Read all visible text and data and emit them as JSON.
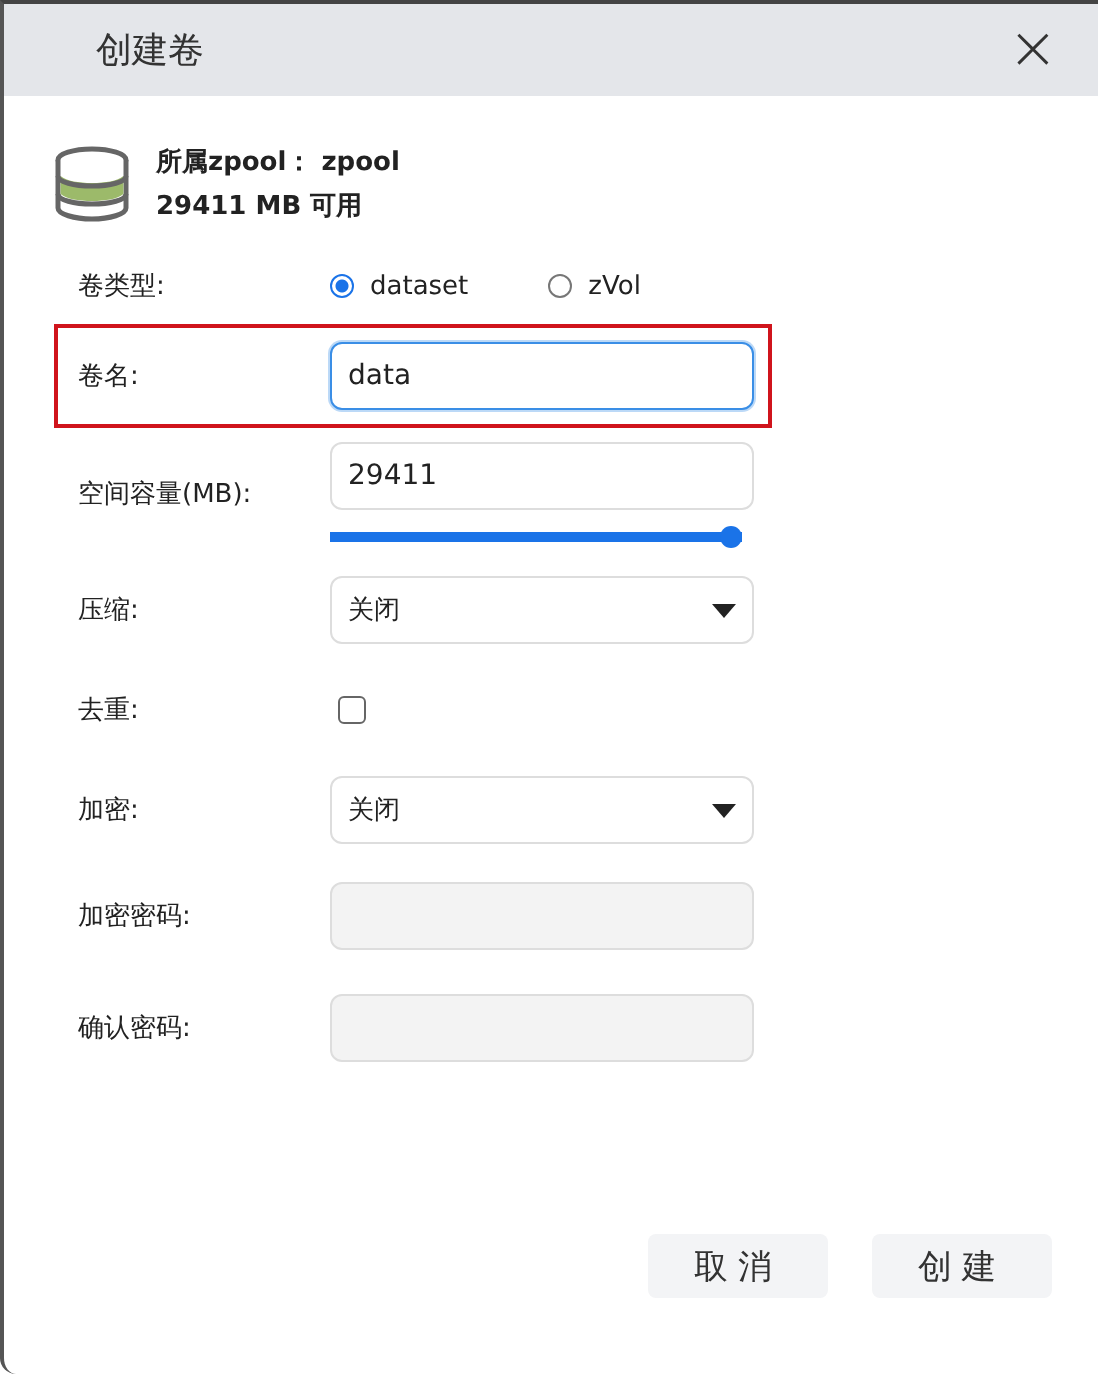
{
  "window": {
    "title": "创建卷",
    "close": "×"
  },
  "pool": {
    "name_line": "所属zpool： zpool",
    "free_line": "29411 MB 可用"
  },
  "fields": [
    {
      "kind": "radio",
      "label": "卷类型:",
      "options": [
        {
          "label": "dataset",
          "selected": true
        },
        {
          "label": "zVol",
          "selected": false
        }
      ]
    },
    {
      "kind": "text",
      "label": "卷名:",
      "value": "data",
      "focused": true,
      "highlighted": true
    },
    {
      "kind": "number",
      "label": "空间容量(MB):",
      "value": "29411",
      "level": 1
    },
    {
      "kind": "select",
      "label": "压缩:",
      "value": "关闭"
    },
    {
      "kind": "checkbox",
      "label": "去重:",
      "checked": false
    },
    {
      "kind": "select",
      "label": "加密:",
      "value": "关闭"
    },
    {
      "kind": "text",
      "label": "加密密码:",
      "disabled": true
    },
    {
      "kind": "text",
      "label": "确认密码:",
      "disabled": true
    }
  ],
  "buttons": [
    "取消",
    "创建"
  ]
}
